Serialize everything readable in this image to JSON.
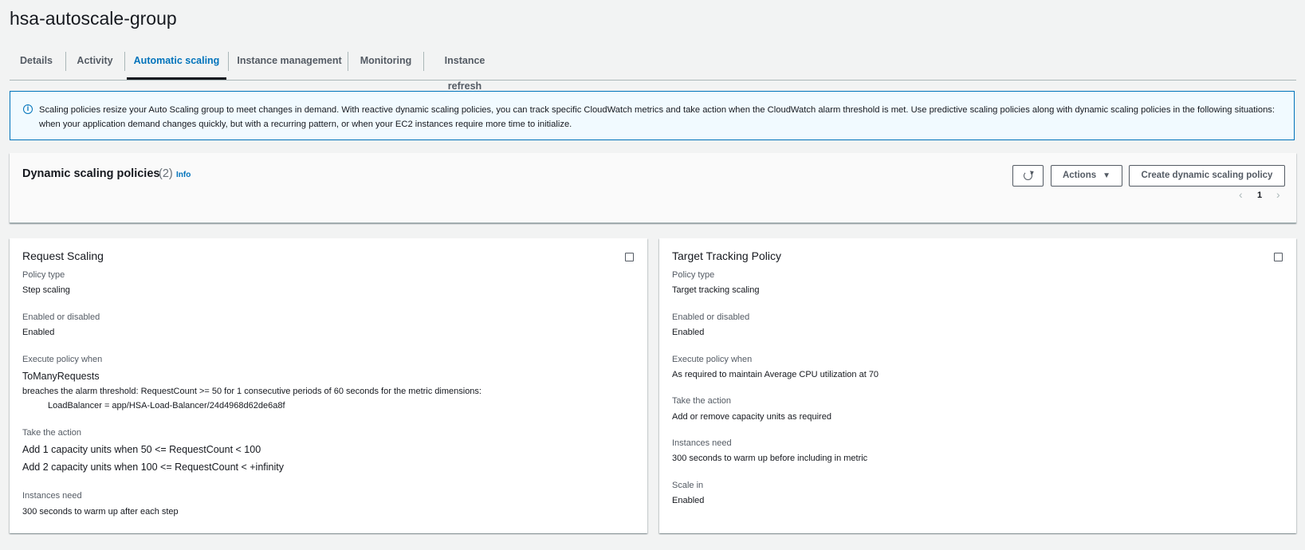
{
  "page_title": "hsa-autoscale-group",
  "tabs": [
    {
      "label": "Details"
    },
    {
      "label": "Activity"
    },
    {
      "label": "Automatic scaling"
    },
    {
      "label": "Instance management"
    },
    {
      "label": "Monitoring"
    },
    {
      "label": "Instance refresh"
    }
  ],
  "active_tab": "Automatic scaling",
  "alert": {
    "icon": "info-icon",
    "text": "Scaling policies resize your Auto Scaling group to meet changes in demand. With reactive dynamic scaling policies, you can track specific CloudWatch metrics and take action when the CloudWatch alarm threshold is met. Use predictive scaling policies along with dynamic scaling policies in the following situations: when your application demand changes quickly, but with a recurring pattern, or when your EC2 instances require more time to initialize."
  },
  "policies_panel": {
    "title": "Dynamic scaling policies",
    "count": "(2)",
    "info_label": "Info",
    "refresh_icon": "refresh-icon",
    "actions_label": "Actions",
    "create_label": "Create dynamic scaling policy",
    "pagination": {
      "current_page": "1",
      "prev_icon": "chevron-left-icon",
      "next_icon": "chevron-right-icon"
    }
  },
  "policy_cards": [
    {
      "title": "Request Scaling",
      "policy_type_label": "Policy type",
      "policy_type": "Step scaling",
      "enabled_label": "Enabled or disabled",
      "enabled": "Enabled",
      "execute_label": "Execute policy when",
      "alarm_name": "ToManyRequests",
      "alarm_desc": "breaches the alarm threshold: RequestCount >= 50 for 1 consecutive periods of 60 seconds for the metric dimensions:",
      "alarm_dimension": "LoadBalancer = app/HSA-Load-Balancer/24d4968d62de6a8f",
      "action_label": "Take the action",
      "actions": [
        "Add 1 capacity units when 50 <= RequestCount < 100",
        "Add 2 capacity units when 100 <= RequestCount < +infinity"
      ],
      "instances_label": "Instances need",
      "instances": "300 seconds to warm up after each step"
    },
    {
      "title": "Target Tracking Policy",
      "policy_type_label": "Policy type",
      "policy_type": "Target tracking scaling",
      "enabled_label": "Enabled or disabled",
      "enabled": "Enabled",
      "execute_label": "Execute policy when",
      "execute_value": "As required to maintain Average CPU utilization at 70",
      "action_label": "Take the action",
      "action_value": "Add or remove capacity units as required",
      "instances_label": "Instances need",
      "instances": "300 seconds to warm up before including in metric",
      "scale_in_label": "Scale in",
      "scale_in": "Enabled"
    }
  ],
  "colors": {
    "accent": "#0073bb",
    "background": "#f2f3f3",
    "alert_bg": "#f1faff",
    "text": "#16191f",
    "secondary_text": "#545b64"
  }
}
